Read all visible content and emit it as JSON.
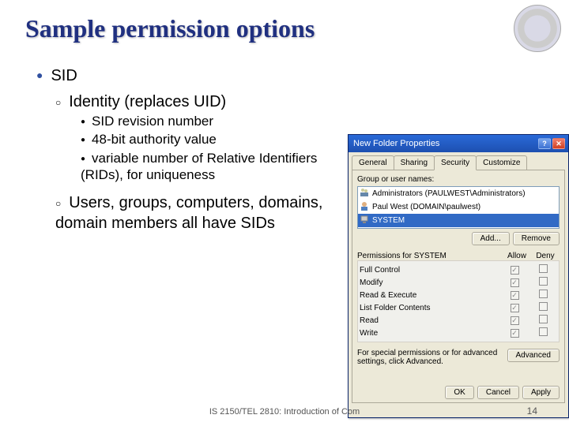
{
  "title": "Sample permission options",
  "footer": "IS 2150/TEL 2810: Introduction of Com",
  "page_num": "14",
  "bullets": {
    "top": "SID",
    "sub_identity": "Identity (replaces UID)",
    "sid_items": [
      "SID revision number",
      "48-bit authority value",
      "variable number of Relative Identifiers (RIDs), for uniqueness"
    ],
    "users_line": "Users, groups, computers, domains, domain members all have SIDs"
  },
  "dialog": {
    "title": "New Folder Properties",
    "help_btn": "?",
    "close_btn": "✕",
    "tabs": [
      "General",
      "Sharing",
      "Security",
      "Customize"
    ],
    "active_tab": 2,
    "group_label": "Group or user names:",
    "principals": [
      "Administrators (PAULWEST\\Administrators)",
      "Paul West (DOMAIN\\paulwest)",
      "SYSTEM"
    ],
    "selected_principal": 2,
    "buttons": {
      "add": "Add...",
      "remove": "Remove",
      "advanced": "Advanced",
      "ok": "OK",
      "cancel": "Cancel",
      "apply": "Apply"
    },
    "perm_header": {
      "title_prefix": "Permissions for ",
      "allow": "Allow",
      "deny": "Deny"
    },
    "permissions": [
      {
        "name": "Full Control",
        "allow": true,
        "deny": false
      },
      {
        "name": "Modify",
        "allow": true,
        "deny": false
      },
      {
        "name": "Read & Execute",
        "allow": true,
        "deny": false
      },
      {
        "name": "List Folder Contents",
        "allow": true,
        "deny": false
      },
      {
        "name": "Read",
        "allow": true,
        "deny": false
      },
      {
        "name": "Write",
        "allow": true,
        "deny": false
      }
    ],
    "special_text": "For special permissions or for advanced settings, click Advanced."
  }
}
